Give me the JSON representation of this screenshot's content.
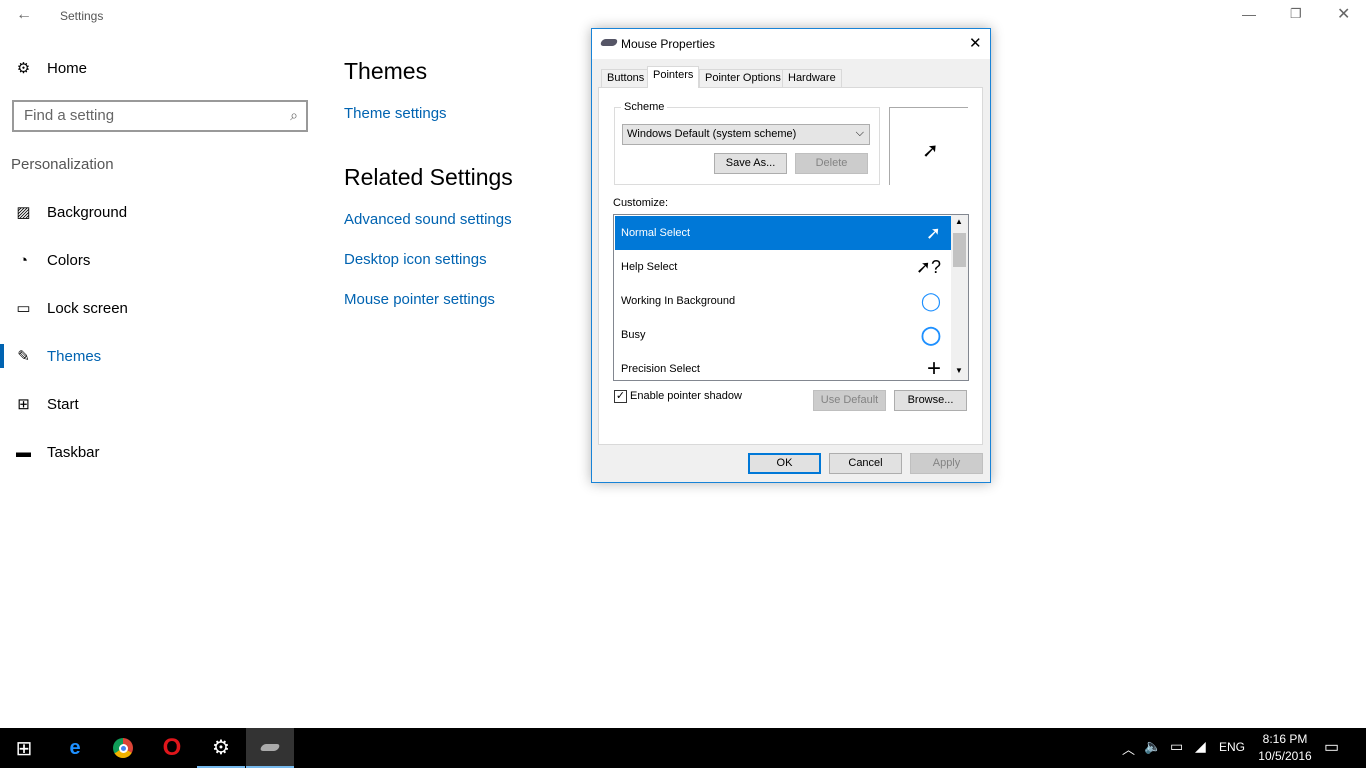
{
  "settings": {
    "title": "Settings",
    "home": "Home",
    "search_placeholder": "Find a setting",
    "section": "Personalization",
    "nav": [
      {
        "label": "Background",
        "icon": "image-icon"
      },
      {
        "label": "Colors",
        "icon": "palette-icon"
      },
      {
        "label": "Lock screen",
        "icon": "lock-screen-icon"
      },
      {
        "label": "Themes",
        "icon": "themes-icon"
      },
      {
        "label": "Start",
        "icon": "start-icon"
      },
      {
        "label": "Taskbar",
        "icon": "taskbar-icon"
      }
    ],
    "heading": "Themes",
    "theme_settings": "Theme settings",
    "related": "Related Settings",
    "links": [
      "Advanced sound settings",
      "Desktop icon settings",
      "Mouse pointer settings"
    ]
  },
  "dialog": {
    "title": "Mouse Properties",
    "tabs": [
      "Buttons",
      "Pointers",
      "Pointer Options",
      "Hardware"
    ],
    "scheme_label": "Scheme",
    "scheme_value": "Windows Default (system scheme)",
    "save_as": "Save As...",
    "delete": "Delete",
    "customize": "Customize:",
    "rows": [
      "Normal Select",
      "Help Select",
      "Working In Background",
      "Busy",
      "Precision Select"
    ],
    "shadow": "Enable pointer shadow",
    "use_default": "Use Default",
    "browse": "Browse...",
    "ok": "OK",
    "cancel": "Cancel",
    "apply": "Apply"
  },
  "taskbar": {
    "time": "8:16 PM",
    "date": "10/5/2016",
    "lang": "ENG"
  }
}
